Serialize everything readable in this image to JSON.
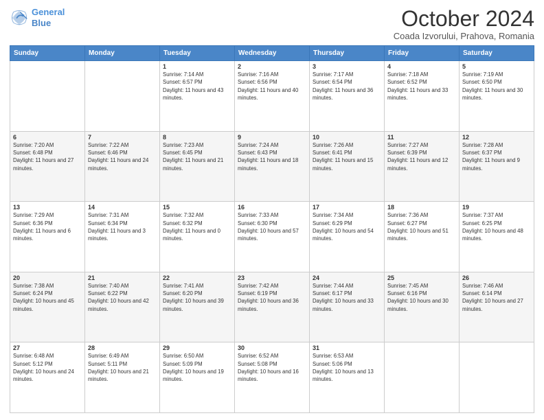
{
  "logo": {
    "line1": "General",
    "line2": "Blue",
    "icon": "▶"
  },
  "title": "October 2024",
  "subtitle": "Coada Izvorului, Prahova, Romania",
  "days_of_week": [
    "Sunday",
    "Monday",
    "Tuesday",
    "Wednesday",
    "Thursday",
    "Friday",
    "Saturday"
  ],
  "weeks": [
    [
      {
        "day": "",
        "sunrise": "",
        "sunset": "",
        "daylight": ""
      },
      {
        "day": "",
        "sunrise": "",
        "sunset": "",
        "daylight": ""
      },
      {
        "day": "1",
        "sunrise": "Sunrise: 7:14 AM",
        "sunset": "Sunset: 6:57 PM",
        "daylight": "Daylight: 11 hours and 43 minutes."
      },
      {
        "day": "2",
        "sunrise": "Sunrise: 7:16 AM",
        "sunset": "Sunset: 6:56 PM",
        "daylight": "Daylight: 11 hours and 40 minutes."
      },
      {
        "day": "3",
        "sunrise": "Sunrise: 7:17 AM",
        "sunset": "Sunset: 6:54 PM",
        "daylight": "Daylight: 11 hours and 36 minutes."
      },
      {
        "day": "4",
        "sunrise": "Sunrise: 7:18 AM",
        "sunset": "Sunset: 6:52 PM",
        "daylight": "Daylight: 11 hours and 33 minutes."
      },
      {
        "day": "5",
        "sunrise": "Sunrise: 7:19 AM",
        "sunset": "Sunset: 6:50 PM",
        "daylight": "Daylight: 11 hours and 30 minutes."
      }
    ],
    [
      {
        "day": "6",
        "sunrise": "Sunrise: 7:20 AM",
        "sunset": "Sunset: 6:48 PM",
        "daylight": "Daylight: 11 hours and 27 minutes."
      },
      {
        "day": "7",
        "sunrise": "Sunrise: 7:22 AM",
        "sunset": "Sunset: 6:46 PM",
        "daylight": "Daylight: 11 hours and 24 minutes."
      },
      {
        "day": "8",
        "sunrise": "Sunrise: 7:23 AM",
        "sunset": "Sunset: 6:45 PM",
        "daylight": "Daylight: 11 hours and 21 minutes."
      },
      {
        "day": "9",
        "sunrise": "Sunrise: 7:24 AM",
        "sunset": "Sunset: 6:43 PM",
        "daylight": "Daylight: 11 hours and 18 minutes."
      },
      {
        "day": "10",
        "sunrise": "Sunrise: 7:26 AM",
        "sunset": "Sunset: 6:41 PM",
        "daylight": "Daylight: 11 hours and 15 minutes."
      },
      {
        "day": "11",
        "sunrise": "Sunrise: 7:27 AM",
        "sunset": "Sunset: 6:39 PM",
        "daylight": "Daylight: 11 hours and 12 minutes."
      },
      {
        "day": "12",
        "sunrise": "Sunrise: 7:28 AM",
        "sunset": "Sunset: 6:37 PM",
        "daylight": "Daylight: 11 hours and 9 minutes."
      }
    ],
    [
      {
        "day": "13",
        "sunrise": "Sunrise: 7:29 AM",
        "sunset": "Sunset: 6:36 PM",
        "daylight": "Daylight: 11 hours and 6 minutes."
      },
      {
        "day": "14",
        "sunrise": "Sunrise: 7:31 AM",
        "sunset": "Sunset: 6:34 PM",
        "daylight": "Daylight: 11 hours and 3 minutes."
      },
      {
        "day": "15",
        "sunrise": "Sunrise: 7:32 AM",
        "sunset": "Sunset: 6:32 PM",
        "daylight": "Daylight: 11 hours and 0 minutes."
      },
      {
        "day": "16",
        "sunrise": "Sunrise: 7:33 AM",
        "sunset": "Sunset: 6:30 PM",
        "daylight": "Daylight: 10 hours and 57 minutes."
      },
      {
        "day": "17",
        "sunrise": "Sunrise: 7:34 AM",
        "sunset": "Sunset: 6:29 PM",
        "daylight": "Daylight: 10 hours and 54 minutes."
      },
      {
        "day": "18",
        "sunrise": "Sunrise: 7:36 AM",
        "sunset": "Sunset: 6:27 PM",
        "daylight": "Daylight: 10 hours and 51 minutes."
      },
      {
        "day": "19",
        "sunrise": "Sunrise: 7:37 AM",
        "sunset": "Sunset: 6:25 PM",
        "daylight": "Daylight: 10 hours and 48 minutes."
      }
    ],
    [
      {
        "day": "20",
        "sunrise": "Sunrise: 7:38 AM",
        "sunset": "Sunset: 6:24 PM",
        "daylight": "Daylight: 10 hours and 45 minutes."
      },
      {
        "day": "21",
        "sunrise": "Sunrise: 7:40 AM",
        "sunset": "Sunset: 6:22 PM",
        "daylight": "Daylight: 10 hours and 42 minutes."
      },
      {
        "day": "22",
        "sunrise": "Sunrise: 7:41 AM",
        "sunset": "Sunset: 6:20 PM",
        "daylight": "Daylight: 10 hours and 39 minutes."
      },
      {
        "day": "23",
        "sunrise": "Sunrise: 7:42 AM",
        "sunset": "Sunset: 6:19 PM",
        "daylight": "Daylight: 10 hours and 36 minutes."
      },
      {
        "day": "24",
        "sunrise": "Sunrise: 7:44 AM",
        "sunset": "Sunset: 6:17 PM",
        "daylight": "Daylight: 10 hours and 33 minutes."
      },
      {
        "day": "25",
        "sunrise": "Sunrise: 7:45 AM",
        "sunset": "Sunset: 6:16 PM",
        "daylight": "Daylight: 10 hours and 30 minutes."
      },
      {
        "day": "26",
        "sunrise": "Sunrise: 7:46 AM",
        "sunset": "Sunset: 6:14 PM",
        "daylight": "Daylight: 10 hours and 27 minutes."
      }
    ],
    [
      {
        "day": "27",
        "sunrise": "Sunrise: 6:48 AM",
        "sunset": "Sunset: 5:12 PM",
        "daylight": "Daylight: 10 hours and 24 minutes."
      },
      {
        "day": "28",
        "sunrise": "Sunrise: 6:49 AM",
        "sunset": "Sunset: 5:11 PM",
        "daylight": "Daylight: 10 hours and 21 minutes."
      },
      {
        "day": "29",
        "sunrise": "Sunrise: 6:50 AM",
        "sunset": "Sunset: 5:09 PM",
        "daylight": "Daylight: 10 hours and 19 minutes."
      },
      {
        "day": "30",
        "sunrise": "Sunrise: 6:52 AM",
        "sunset": "Sunset: 5:08 PM",
        "daylight": "Daylight: 10 hours and 16 minutes."
      },
      {
        "day": "31",
        "sunrise": "Sunrise: 6:53 AM",
        "sunset": "Sunset: 5:06 PM",
        "daylight": "Daylight: 10 hours and 13 minutes."
      },
      {
        "day": "",
        "sunrise": "",
        "sunset": "",
        "daylight": ""
      },
      {
        "day": "",
        "sunrise": "",
        "sunset": "",
        "daylight": ""
      }
    ]
  ]
}
